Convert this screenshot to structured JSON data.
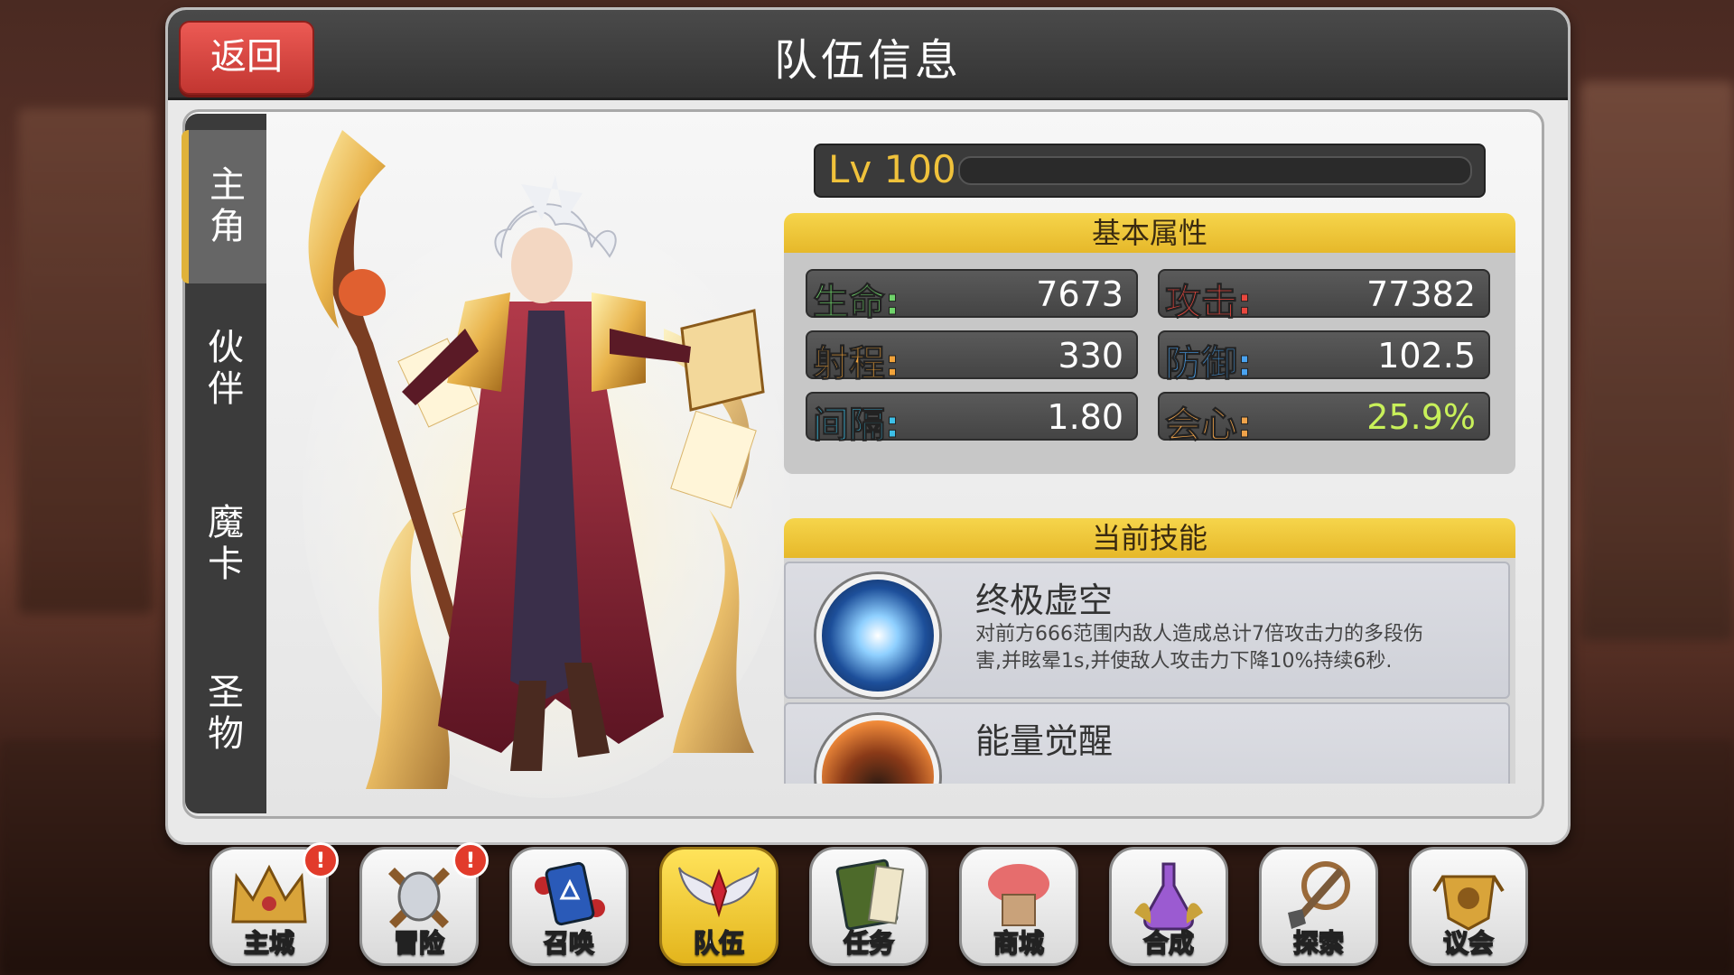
{
  "header": {
    "title": "队伍信息",
    "back_label": "返回"
  },
  "side_tabs": [
    {
      "label": "主角",
      "active": true
    },
    {
      "label": "伙伴",
      "active": false
    },
    {
      "label": "魔卡",
      "active": false
    },
    {
      "label": "圣物",
      "active": false
    }
  ],
  "level": {
    "text": "Lv 100",
    "progress": 0
  },
  "stats": {
    "header": "基本属性",
    "items": [
      {
        "label": "生命:",
        "value": "7673",
        "label_color": "#6fd36a",
        "value_color": "#ffffff"
      },
      {
        "label": "攻击:",
        "value": "77382",
        "label_color": "#e8473e",
        "value_color": "#ffffff"
      },
      {
        "label": "射程:",
        "value": "330",
        "label_color": "#f2a33a",
        "value_color": "#ffffff"
      },
      {
        "label": "防御:",
        "value": "102.5",
        "label_color": "#4aa3f0",
        "value_color": "#ffffff"
      },
      {
        "label": "间隔:",
        "value": "1.80",
        "label_color": "#3dc0e8",
        "value_color": "#ffffff"
      },
      {
        "label": "会心:",
        "value": "25.9%",
        "label_color": "#f0a34a",
        "value_color": "#c8f05a"
      }
    ]
  },
  "skills": {
    "header": "当前技能",
    "items": [
      {
        "name": "终极虚空",
        "desc": "对前方666范围内敌人造成总计7倍攻击力的多段伤害,并眩晕1s,并使敌人攻击力下降10%持续6秒.",
        "icon": "void-vortex-icon"
      },
      {
        "name": "能量觉醒",
        "desc": "",
        "icon": "energy-awaken-icon"
      }
    ]
  },
  "nav": [
    {
      "label": "主城",
      "icon": "crown-icon",
      "alert": true,
      "active": false
    },
    {
      "label": "冒险",
      "icon": "crossed-axes-icon",
      "alert": true,
      "active": false
    },
    {
      "label": "召唤",
      "icon": "summon-card-icon",
      "alert": false,
      "active": false
    },
    {
      "label": "队伍",
      "icon": "winged-emblem-icon",
      "alert": false,
      "active": true
    },
    {
      "label": "任务",
      "icon": "quest-book-icon",
      "alert": false,
      "active": false
    },
    {
      "label": "商城",
      "icon": "shop-tree-icon",
      "alert": false,
      "active": false
    },
    {
      "label": "合成",
      "icon": "potion-flask-icon",
      "alert": false,
      "active": false
    },
    {
      "label": "探索",
      "icon": "shovel-icon",
      "alert": false,
      "active": false
    },
    {
      "label": "议会",
      "icon": "council-crest-icon",
      "alert": false,
      "active": false
    }
  ],
  "alert_mark": "!"
}
